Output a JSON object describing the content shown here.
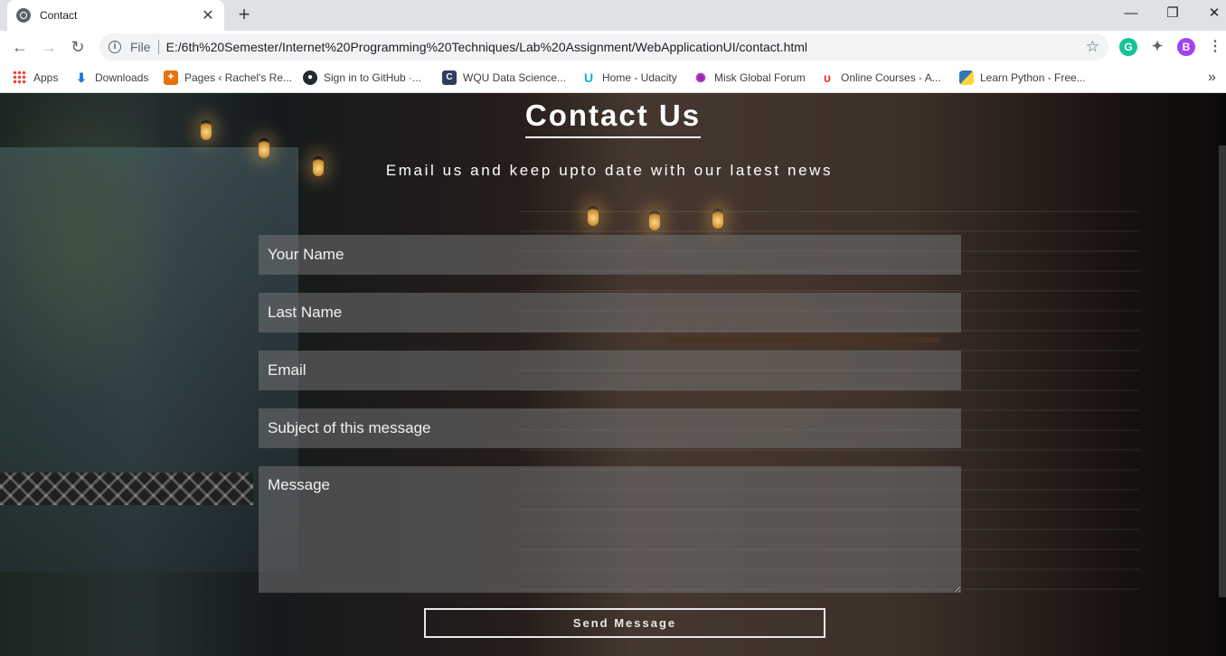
{
  "browser": {
    "tab_title": "Contact",
    "tab_close": "✕",
    "new_tab": "+",
    "controls": {
      "minimize": "—",
      "restore": "❐",
      "close": "✕"
    },
    "nav": {
      "back": "←",
      "forward": "→",
      "reload": "↻"
    },
    "address": {
      "info": "i",
      "file_label": "File",
      "url": "E:/6th%20Semester/Internet%20Programming%20Techniques/Lab%20Assignment/WebApplicationUI/contact.html",
      "star": "☆"
    },
    "extensions": {
      "grammarly": "G",
      "puzzle": "✦",
      "profile": "B",
      "menu": "⋮"
    },
    "bookmarks": [
      {
        "label": "Apps",
        "icon": "apps-grid-icon",
        "color": "#ea4335"
      },
      {
        "label": "Downloads",
        "icon": "download-icon",
        "color": "#1a73e8"
      },
      {
        "label": "Pages ‹ Rachel's Re...",
        "icon": "pages-icon",
        "color": "#e8710a"
      },
      {
        "label": "Sign in to GitHub ·...",
        "icon": "github-icon",
        "color": "#24292e"
      },
      {
        "label": "WQU Data Science...",
        "icon": "wqu-icon",
        "color": "#2d3e5f"
      },
      {
        "label": "Home - Udacity",
        "icon": "udacity-icon",
        "color": "#02b3e4"
      },
      {
        "label": "Misk Global Forum",
        "icon": "misk-icon",
        "color": "#9c27b0"
      },
      {
        "label": "Online Courses - A...",
        "icon": "courses-icon",
        "color": "#e53935"
      },
      {
        "label": "Learn Python - Free...",
        "icon": "python-icon",
        "color": "#3776ab"
      }
    ],
    "bookmarks_more": "»"
  },
  "page": {
    "heading": "Contact Us",
    "subtitle": "Email us and keep upto date with our latest news",
    "form": {
      "first_name_placeholder": "Your Name",
      "last_name_placeholder": "Last Name",
      "email_placeholder": "Email",
      "subject_placeholder": "Subject of this message",
      "message_placeholder": "Message",
      "submit_label": "Send Message"
    }
  }
}
